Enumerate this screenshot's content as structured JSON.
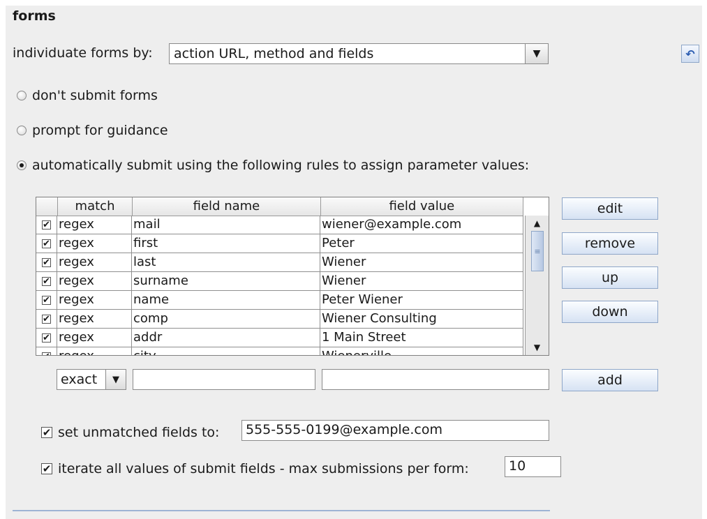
{
  "section": {
    "title": "forms"
  },
  "individuate": {
    "label": "individuate forms by:",
    "selected": "action URL, method and fields"
  },
  "radios": [
    {
      "label": "don't submit forms",
      "checked": false
    },
    {
      "label": "prompt for guidance",
      "checked": false
    },
    {
      "label": "automatically submit using the following rules to assign parameter values:",
      "checked": true
    }
  ],
  "table": {
    "headers": [
      "match",
      "field name",
      "field value"
    ],
    "rows": [
      {
        "checked": true,
        "match": "regex",
        "name": "mail",
        "value": "wiener@example.com"
      },
      {
        "checked": true,
        "match": "regex",
        "name": "first",
        "value": "Peter"
      },
      {
        "checked": true,
        "match": "regex",
        "name": "last",
        "value": "Wiener"
      },
      {
        "checked": true,
        "match": "regex",
        "name": "surname",
        "value": "Wiener"
      },
      {
        "checked": true,
        "match": "regex",
        "name": "name",
        "value": "Peter Wiener"
      },
      {
        "checked": true,
        "match": "regex",
        "name": "comp",
        "value": "Wiener Consulting"
      },
      {
        "checked": true,
        "match": "regex",
        "name": "addr",
        "value": "1 Main Street"
      },
      {
        "checked": true,
        "match": "regex",
        "name": "city",
        "value": "Wienerville"
      }
    ]
  },
  "buttons": {
    "edit": "edit",
    "remove": "remove",
    "up": "up",
    "down": "down",
    "add": "add"
  },
  "add_row": {
    "match_selected": "exact",
    "name_value": "",
    "value_value": ""
  },
  "unmatched": {
    "label": "set unmatched fields to:",
    "checked": true,
    "value": "555-555-0199@example.com"
  },
  "iterate": {
    "label": "iterate all values of submit fields - max submissions per form:",
    "checked": true,
    "value": "10"
  },
  "icons": {
    "checkmark": "✔",
    "dropdown": "▼",
    "scroll_up": "▲",
    "scroll_down": "▼",
    "reset": "↶"
  }
}
